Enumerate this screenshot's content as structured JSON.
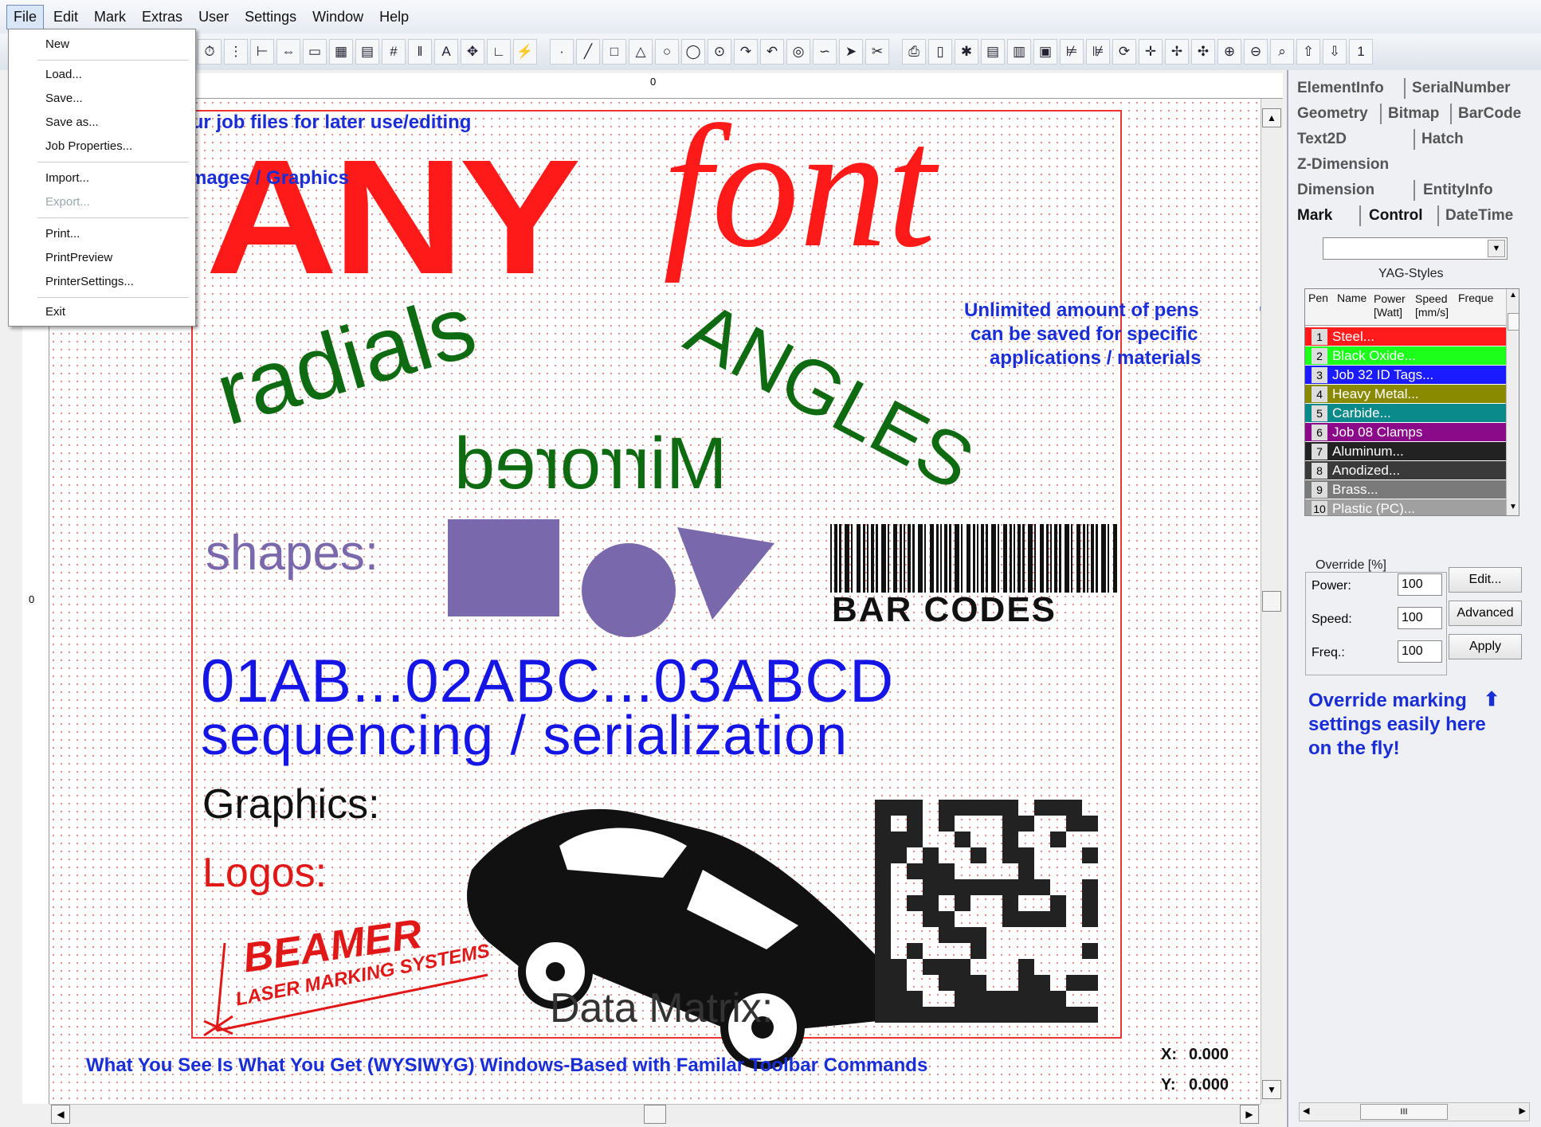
{
  "menubar": {
    "items": [
      "File",
      "Edit",
      "Mark",
      "Extras",
      "User",
      "Settings",
      "Window",
      "Help"
    ]
  },
  "file_menu": {
    "items": [
      "New",
      "Load...",
      "Save...",
      "Save as...",
      "Job Properties...",
      "Import...",
      "Export...",
      "Print...",
      "PrintPreview",
      "PrinterSettings...",
      "Exit"
    ]
  },
  "annotations": {
    "save": "Save your job files for later use/editing",
    "import": "Import Images / Graphics",
    "pens_1": "Unlimited amount of pens",
    "pens_2": "can be saved for specific",
    "pens_3": "applications / materials",
    "override_1": "Override marking",
    "override_2": "settings easily here",
    "override_3": "on the fly!",
    "bottom": "What You See Is What You Get (WYSIWYG) Windows-Based with Familar Toolbar Commands"
  },
  "canvas": {
    "any": "ANY",
    "font": "font",
    "radials": "radials",
    "angles": "ANGLES",
    "mirrored": "Mirrored",
    "shapes": "shapes:",
    "bar_codes": "BAR CODES",
    "sequence": "01AB...02ABC...03ABCD",
    "sequencing": "sequencing / serialization",
    "graphics": "Graphics:",
    "logos": "Logos:",
    "logo_1": "BEAMER",
    "logo_2": "LASER MARKING SYSTEMS",
    "data_matrix": "Data Matrix:"
  },
  "coords": {
    "x_label": "X:",
    "x": "0.000",
    "y_label": "Y:",
    "y": "0.000"
  },
  "ruler_mark": "0",
  "right_panel": {
    "tabs": [
      "ElementInfo",
      "SerialNumber",
      "Geometry",
      "Bitmap",
      "BarCode",
      "Text2D",
      "Hatch",
      "Z-Dimension",
      "Dimension",
      "EntityInfo",
      "Mark",
      "Control",
      "DateTime"
    ],
    "style_label": "YAG-Styles",
    "headers": [
      "Pen",
      "Name",
      "Power [Watt]",
      "Speed [mm/s]",
      "Freque"
    ],
    "pens": [
      {
        "num": "1",
        "name": "Steel...",
        "color": "#ff1b1b"
      },
      {
        "num": "2",
        "name": "Black Oxide...",
        "color": "#1bff1b"
      },
      {
        "num": "3",
        "name": "Job 32 ID Tags...",
        "color": "#1b1bff"
      },
      {
        "num": "4",
        "name": "Heavy Metal...",
        "color": "#8a8a00"
      },
      {
        "num": "5",
        "name": "Carbide...",
        "color": "#0a8a8a"
      },
      {
        "num": "6",
        "name": "Job 08 Clamps",
        "color": "#8a0a8a"
      },
      {
        "num": "7",
        "name": "Aluminum...",
        "color": "#222222"
      },
      {
        "num": "8",
        "name": "Anodized...",
        "color": "#3a3a3a"
      },
      {
        "num": "9",
        "name": "Brass...",
        "color": "#7a7a7a"
      },
      {
        "num": "10",
        "name": "Plastic (PC)...",
        "color": "#a0a0a0"
      }
    ],
    "override_title": "Override [%]",
    "power_label": "Power:",
    "speed_label": "Speed:",
    "freq_label": "Freq.:",
    "power": "100",
    "speed": "100",
    "freq": "100",
    "edit_btn": "Edit...",
    "advanced_btn": "Advanced",
    "apply_btn": "Apply",
    "scroll_glyph": "III"
  },
  "colors": {
    "red": "#ff1a1a",
    "green": "#0e6b12",
    "blue": "#1515e6",
    "purple": "#7a68ad",
    "annotation": "#1a2ed8"
  }
}
